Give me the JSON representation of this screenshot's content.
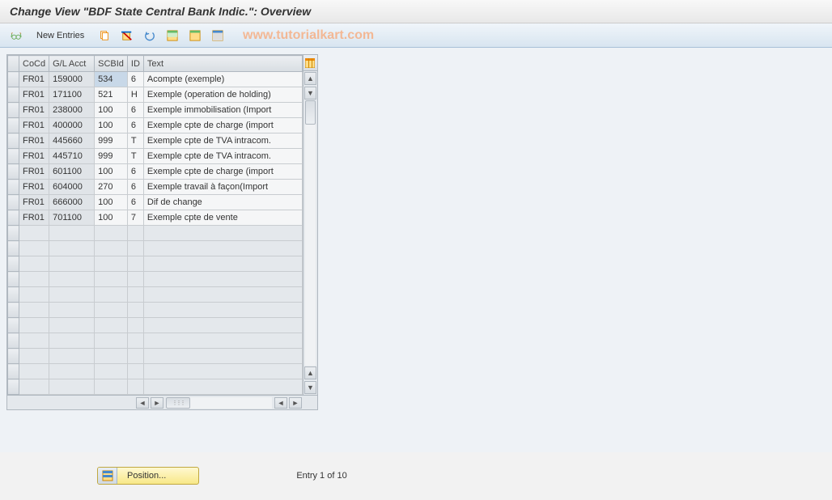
{
  "title": "Change View \"BDF State Central Bank Indic.\": Overview",
  "watermark": "www.tutorialkart.com",
  "toolbar": {
    "new_entries_label": "New Entries"
  },
  "table": {
    "headers": {
      "cocd": "CoCd",
      "glacct": "G/L Acct",
      "scbid": "SCBId",
      "id": "ID",
      "text": "Text"
    },
    "rows": [
      {
        "cocd": "FR01",
        "glacct": "159000",
        "scbid": "534",
        "id": "6",
        "text": "Acompte (exemple)",
        "selected": true
      },
      {
        "cocd": "FR01",
        "glacct": "171100",
        "scbid": "521",
        "id": "H",
        "text": "Exemple (operation de holding)"
      },
      {
        "cocd": "FR01",
        "glacct": "238000",
        "scbid": "100",
        "id": "6",
        "text": "Exemple immobilisation (Import"
      },
      {
        "cocd": "FR01",
        "glacct": "400000",
        "scbid": "100",
        "id": "6",
        "text": "Exemple cpte de charge (import"
      },
      {
        "cocd": "FR01",
        "glacct": "445660",
        "scbid": "999",
        "id": "T",
        "text": "Exemple cpte de TVA intracom."
      },
      {
        "cocd": "FR01",
        "glacct": "445710",
        "scbid": "999",
        "id": "T",
        "text": "Exemple cpte de TVA intracom."
      },
      {
        "cocd": "FR01",
        "glacct": "601100",
        "scbid": "100",
        "id": "6",
        "text": "Exemple cpte de charge (import"
      },
      {
        "cocd": "FR01",
        "glacct": "604000",
        "scbid": "270",
        "id": "6",
        "text": "Exemple travail à façon(Import"
      },
      {
        "cocd": "FR01",
        "glacct": "666000",
        "scbid": "100",
        "id": "6",
        "text": "Dif de change"
      },
      {
        "cocd": "FR01",
        "glacct": "701100",
        "scbid": "100",
        "id": "7",
        "text": "Exemple cpte de vente"
      }
    ],
    "empty_row_count": 11
  },
  "footer": {
    "position_label": "Position...",
    "entry_text": "Entry 1 of 10"
  }
}
